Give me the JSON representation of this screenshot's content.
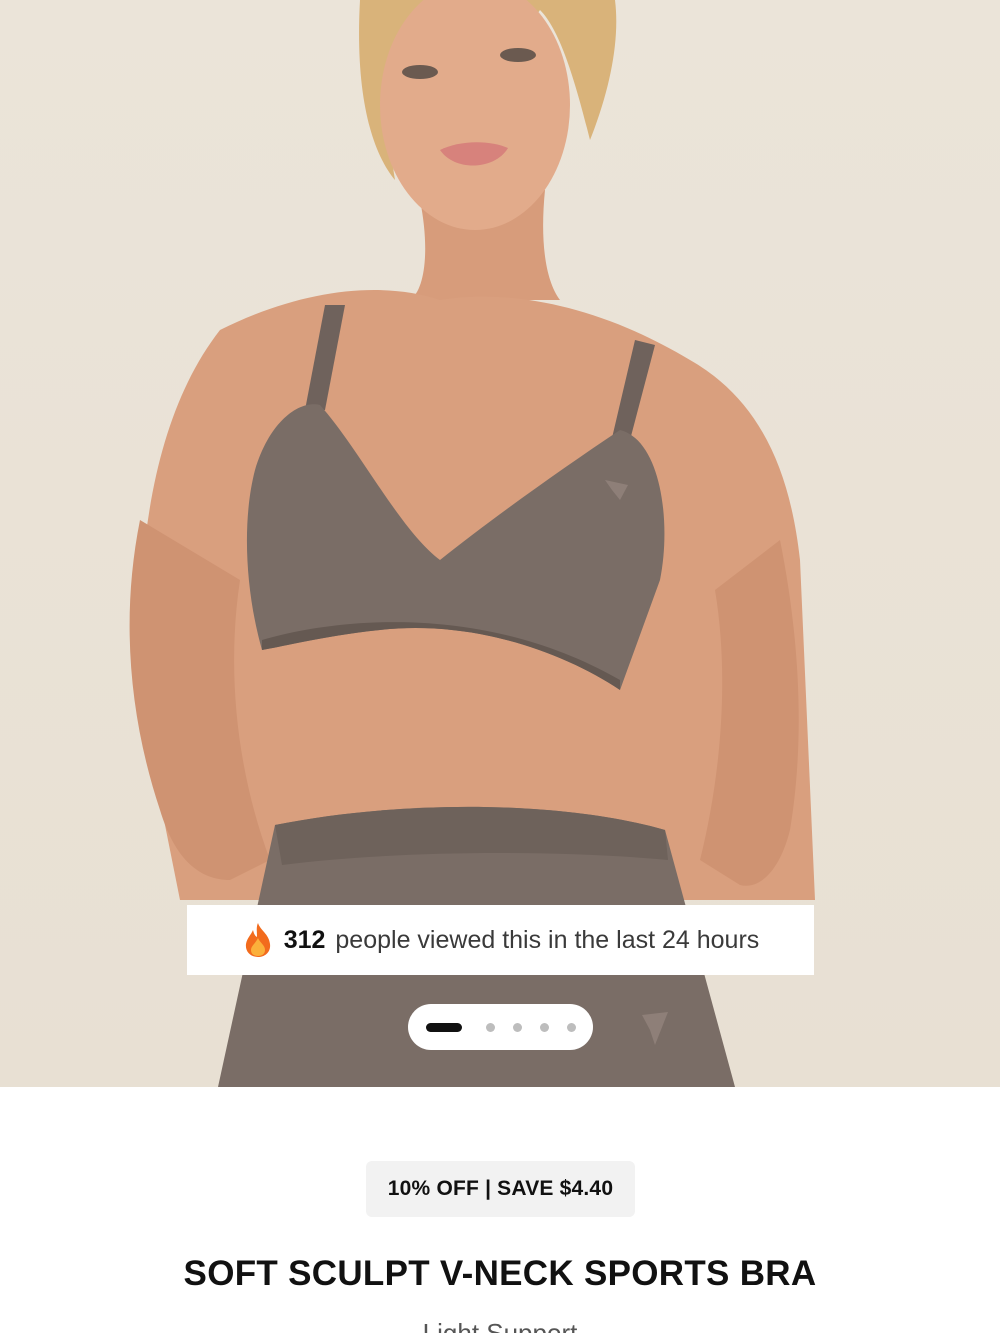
{
  "hero": {
    "image_alt": "Model wearing soft sculpt v-neck sports bra and leggings",
    "views_banner": {
      "icon": "fire-icon",
      "count": "312",
      "text": "people viewed this in the last 24 hours"
    },
    "carousel": {
      "total": 5,
      "active_index": 0
    }
  },
  "product": {
    "discount_label": "10% OFF | SAVE $4.40",
    "title": "SOFT SCULPT V-NECK SPORTS BRA",
    "subtitle": "Light Support"
  },
  "colors": {
    "background": "#e9e2d6",
    "garment": "#7a6d66",
    "text_primary": "#111111"
  }
}
